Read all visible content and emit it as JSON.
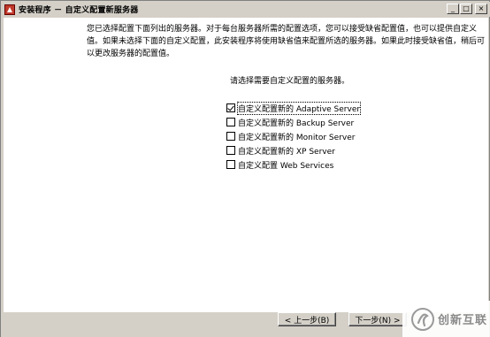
{
  "window": {
    "title": "安装程序 － 自定义配置新服务器"
  },
  "intro_text": "您已选择配置下面列出的服务器。对于每台服务器所需的配置选项，您可以接受缺省配置值，也可以提供自定义值。如果未选择下面的自定义配置，此安装程序将使用缺省值来配置所选的服务器。如果此时接受缺省值，稍后可以更改服务器的配置值。",
  "prompt": "请选择需要自定义配置的服务器。",
  "servers": [
    {
      "label": "自定义配置新的 Adaptive Server",
      "checked": true
    },
    {
      "label": "自定义配置新的 Backup Server",
      "checked": false
    },
    {
      "label": "自定义配置新的 Monitor Server",
      "checked": false
    },
    {
      "label": "自定义配置新的 XP Server",
      "checked": false
    },
    {
      "label": "自定义配置 Web Services",
      "checked": false
    }
  ],
  "buttons": {
    "back": "< 上一步(B)",
    "next": "下一步(N) >"
  },
  "watermark": {
    "text": "创新互联"
  }
}
